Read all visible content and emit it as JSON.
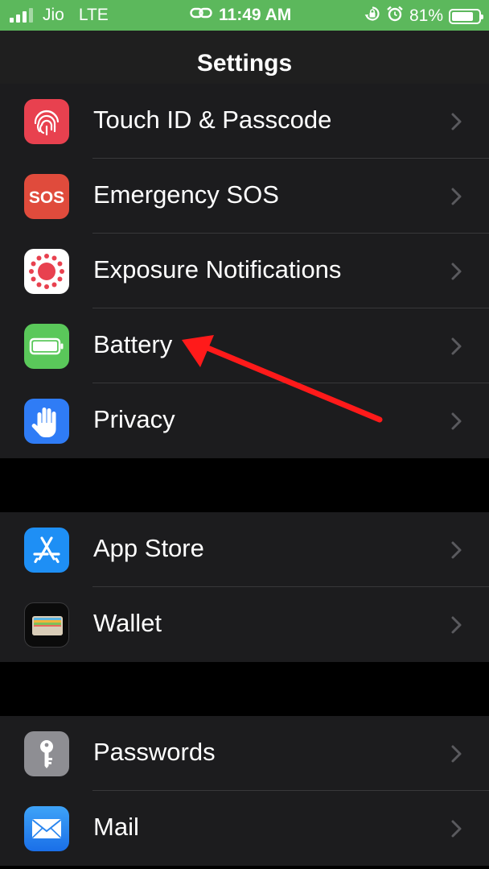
{
  "status_bar": {
    "carrier": "Jio",
    "network": "LTE",
    "time": "11:49 AM",
    "battery_percent": "81%",
    "battery_level": 0.81,
    "background": "#5cb85c"
  },
  "nav": {
    "title": "Settings"
  },
  "groups": [
    {
      "items": [
        {
          "label": "Touch ID & Passcode",
          "icon": "fingerprint-icon"
        },
        {
          "label": "Emergency SOS",
          "icon": "sos-icon",
          "icon_text": "SOS"
        },
        {
          "label": "Exposure Notifications",
          "icon": "exposure-icon"
        },
        {
          "label": "Battery",
          "icon": "battery-icon"
        },
        {
          "label": "Privacy",
          "icon": "hand-icon"
        }
      ]
    },
    {
      "items": [
        {
          "label": "App Store",
          "icon": "app-store-icon"
        },
        {
          "label": "Wallet",
          "icon": "wallet-icon"
        }
      ]
    },
    {
      "items": [
        {
          "label": "Passwords",
          "icon": "key-icon"
        },
        {
          "label": "Mail",
          "icon": "mail-icon"
        }
      ]
    }
  ],
  "annotation": {
    "type": "red-arrow",
    "points_to": "Battery",
    "color": "#ff1a1a"
  }
}
